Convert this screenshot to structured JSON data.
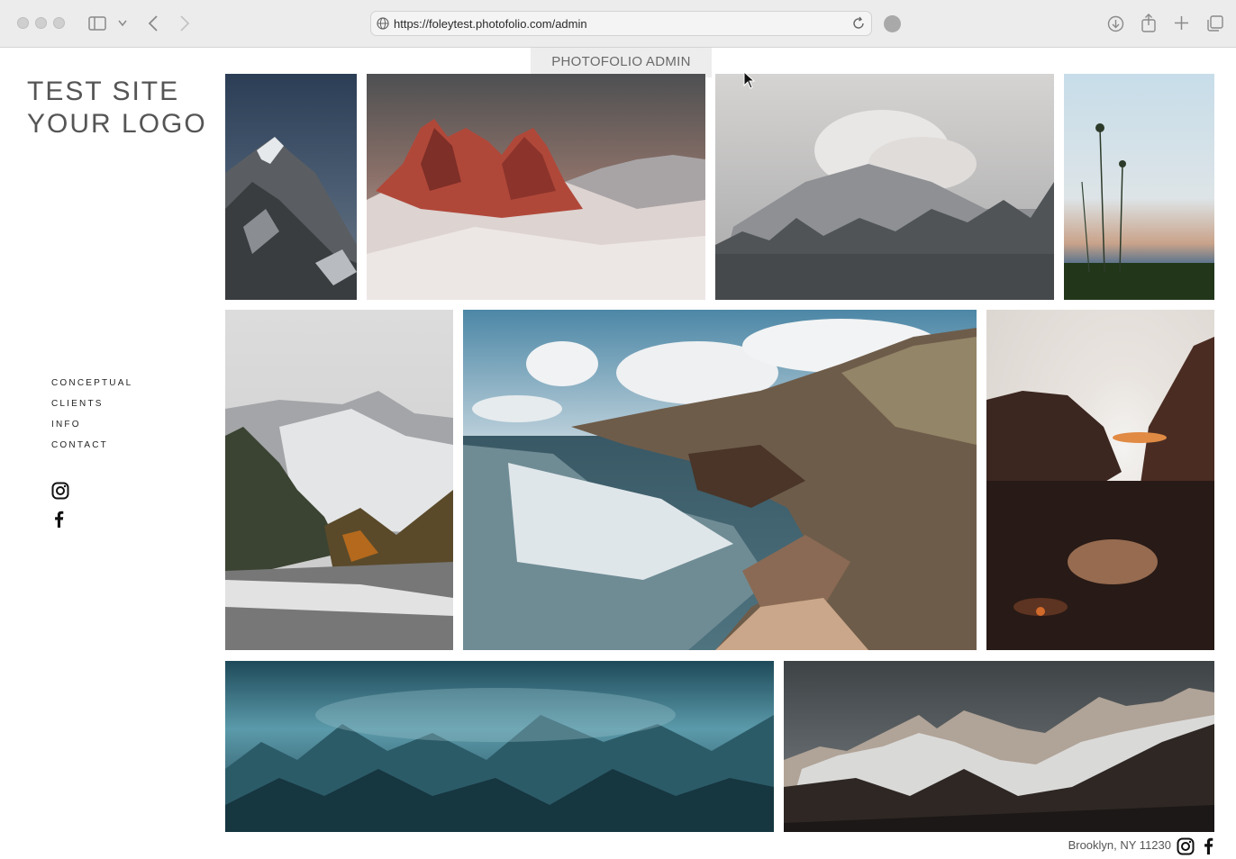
{
  "browser": {
    "url": "https://foleytest.photofolio.com/admin",
    "icons": [
      "sidebar-icon",
      "chevron-down-icon",
      "back-icon",
      "forward-icon",
      "globe-icon",
      "reload-icon",
      "extension-icon",
      "download-icon",
      "share-icon",
      "new-tab-icon",
      "tabs-overview-icon"
    ]
  },
  "admin_bar": {
    "label": "PHOTOFOLIO ADMIN"
  },
  "site": {
    "logo_line1": "TEST SITE",
    "logo_line2": "YOUR LOGO",
    "nav": [
      {
        "label": "CONCEPTUAL"
      },
      {
        "label": "CLIENTS"
      },
      {
        "label": "INFO"
      },
      {
        "label": "CONTACT"
      }
    ],
    "social_icons": [
      "instagram-icon",
      "facebook-icon"
    ]
  },
  "gallery": {
    "photos": [
      {
        "name": "photo-snowy-peak-night"
      },
      {
        "name": "photo-red-rock-mountain"
      },
      {
        "name": "photo-cloudy-mountain-forest"
      },
      {
        "name": "photo-grass-silhouette"
      },
      {
        "name": "photo-snowy-valley-river"
      },
      {
        "name": "photo-coastal-cliffs"
      },
      {
        "name": "photo-sunset-rocks"
      },
      {
        "name": "photo-misty-teal-forest"
      },
      {
        "name": "photo-mountain-range-dusk"
      }
    ]
  },
  "footer": {
    "location": "Brooklyn, NY 11230"
  },
  "colors": {
    "chrome": "#ececec",
    "text": "#555555",
    "nav": "#222222"
  }
}
